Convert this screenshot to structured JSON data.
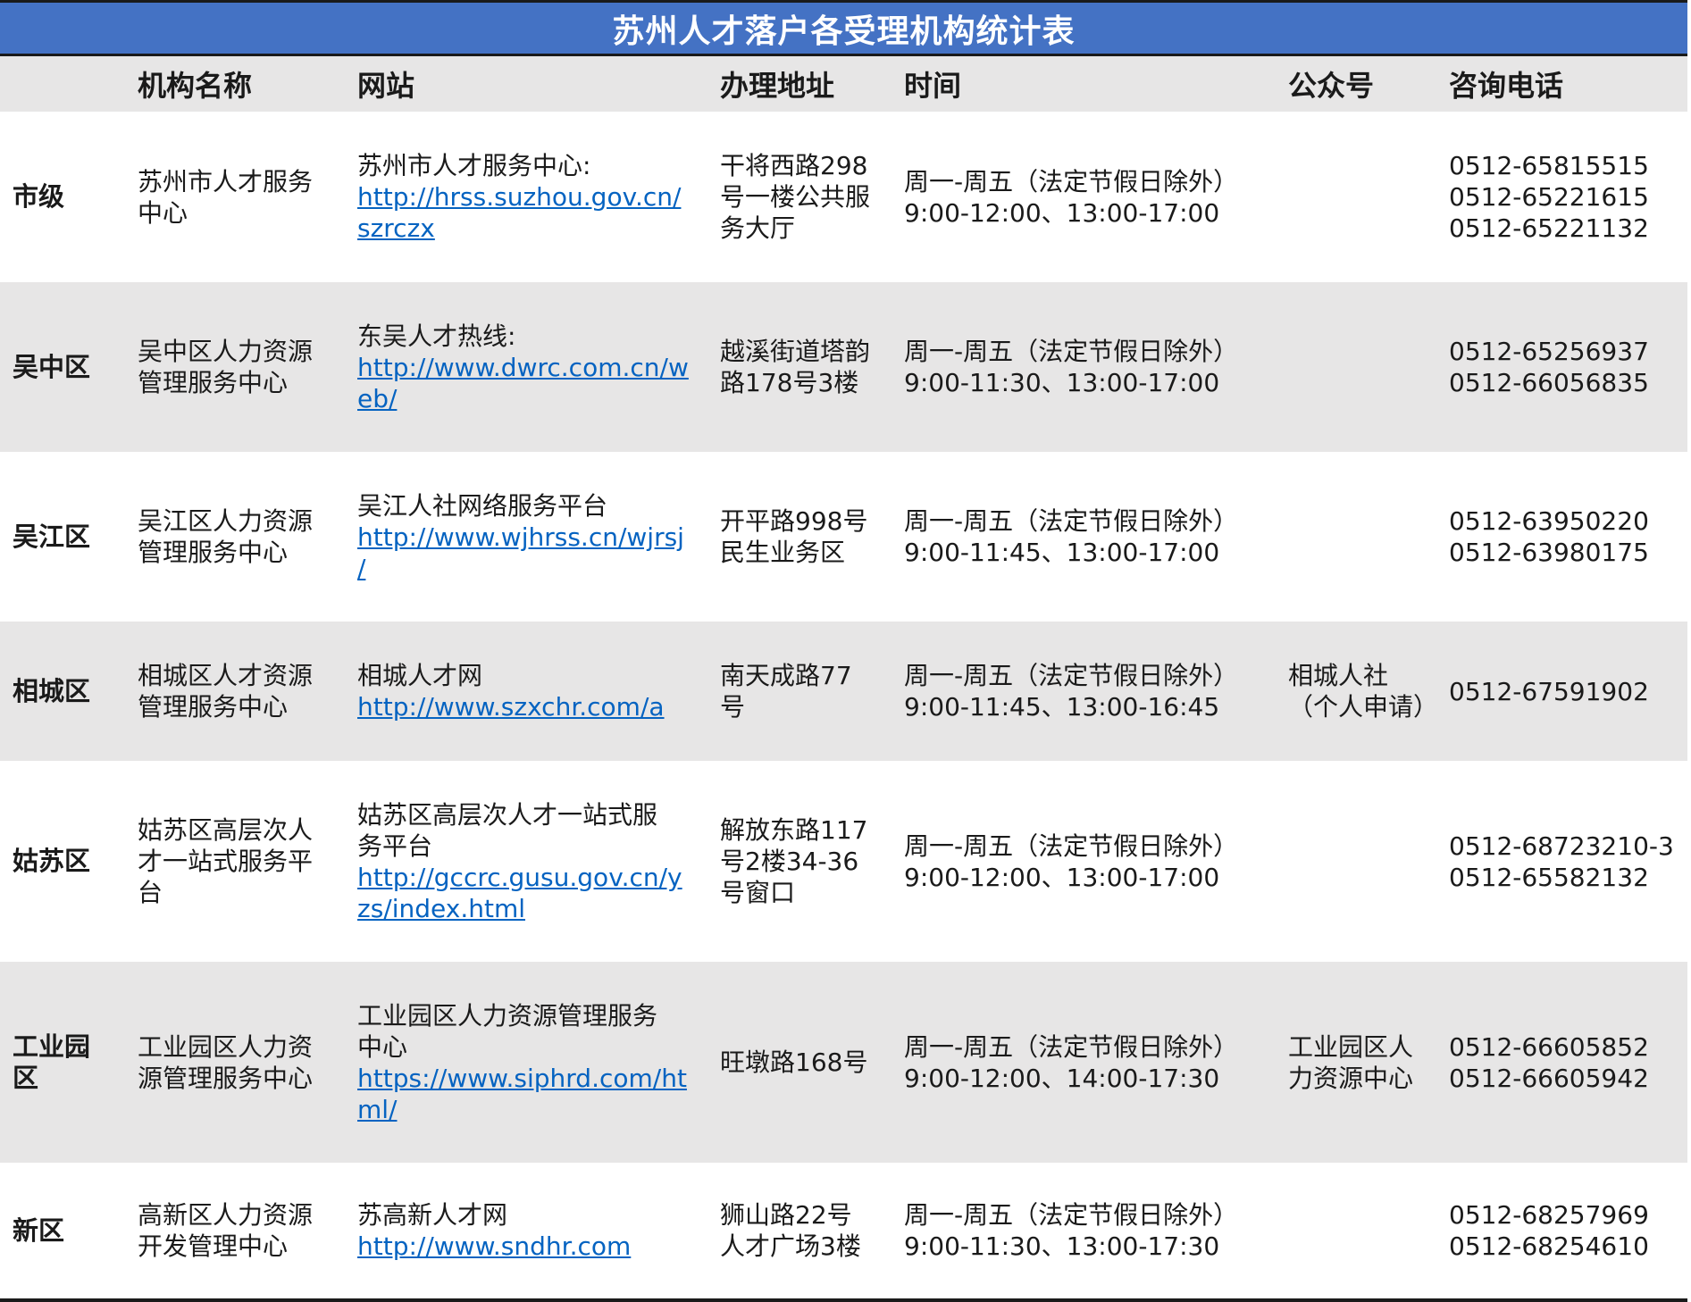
{
  "title": "苏州人才落户各受理机构统计表",
  "headers": {
    "org": "机构名称",
    "site": "网站",
    "addr": "办理地址",
    "time": "时间",
    "wechat": "公众号",
    "phone": "咨询电话"
  },
  "rows": [
    {
      "district": "市级",
      "org": [
        "苏州市人才服务",
        "中心"
      ],
      "site_name": [
        "苏州市人才服务中心:"
      ],
      "site_url": [
        "http://hrss.suzhou.gov.cn/",
        "szrczx"
      ],
      "addr": [
        "干将西路298",
        "号一楼公共服",
        "务大厅"
      ],
      "time": [
        "周一-周五（法定节假日除外）",
        "9:00-12:00、13:00-17:00"
      ],
      "wechat": [],
      "phones": [
        "0512-65815515",
        "0512-65221615",
        "0512-65221132"
      ]
    },
    {
      "district": "吴中区",
      "org": [
        "吴中区人力资源",
        "管理服务中心"
      ],
      "site_name": [
        "东吴人才热线:"
      ],
      "site_url": [
        "http://www.dwrc.com.cn/w",
        "eb/"
      ],
      "addr": [
        "越溪街道塔韵",
        "路178号3楼"
      ],
      "time": [
        "周一-周五（法定节假日除外）",
        "9:00-11:30、13:00-17:00"
      ],
      "wechat": [],
      "phones": [
        "0512-65256937",
        "0512-66056835"
      ]
    },
    {
      "district": "吴江区",
      "org": [
        "吴江区人力资源",
        "管理服务中心"
      ],
      "site_name": [
        "吴江人社网络服务平台"
      ],
      "site_url": [
        "http://www.wjhrss.cn/wjrsj",
        "/"
      ],
      "addr": [
        "开平路998号",
        "民生业务区"
      ],
      "time": [
        "周一-周五（法定节假日除外）",
        "9:00-11:45、13:00-17:00"
      ],
      "wechat": [],
      "phones": [
        "0512-63950220",
        "0512-63980175"
      ]
    },
    {
      "district": "相城区",
      "org": [
        "相城区人才资源",
        "管理服务中心"
      ],
      "site_name": [
        "相城人才网"
      ],
      "site_url": [
        "http://www.szxchr.com/a"
      ],
      "addr": [
        "南天成路77",
        "号"
      ],
      "time": [
        "周一-周五（法定节假日除外）",
        "9:00-11:45、13:00-16:45"
      ],
      "wechat": [
        "相城人社",
        "（个人申请）"
      ],
      "phones": [
        "0512-67591902"
      ]
    },
    {
      "district": "姑苏区",
      "org": [
        "姑苏区高层次人",
        "才一站式服务平",
        "台"
      ],
      "site_name": [
        "姑苏区高层次人才一站式服",
        "务平台"
      ],
      "site_url": [
        "http://gccrc.gusu.gov.cn/y",
        "zs/index.html"
      ],
      "addr": [
        "解放东路117",
        "号2楼34-36",
        "号窗口"
      ],
      "time": [
        "周一-周五（法定节假日除外）",
        "9:00-12:00、13:00-17:00"
      ],
      "wechat": [],
      "phones": [
        "0512-68723210-3",
        "0512-65582132"
      ]
    },
    {
      "district": "工业园区",
      "district_lines": [
        "工业园",
        "区"
      ],
      "org": [
        "工业园区人力资",
        "源管理服务中心"
      ],
      "site_name": [
        "工业园区人力资源管理服务",
        "中心"
      ],
      "site_url": [
        "https://www.siphrd.com/ht",
        "ml/"
      ],
      "addr": [
        "旺墩路168号"
      ],
      "time": [
        "周一-周五（法定节假日除外）",
        "9:00-12:00、14:00-17:30"
      ],
      "wechat": [
        "工业园区人",
        "力资源中心"
      ],
      "phones": [
        "0512-66605852",
        "0512-66605942"
      ]
    },
    {
      "district": "新区",
      "org": [
        "高新区人力资源",
        "开发管理中心"
      ],
      "site_name": [
        "苏高新人才网"
      ],
      "site_url": [
        "http://www.sndhr.com"
      ],
      "addr": [
        "狮山路22号",
        "人才广场3楼"
      ],
      "time": [
        "周一-周五（法定节假日除外）",
        "9:00-11:30、13:00-17:30"
      ],
      "wechat": [],
      "phones": [
        "0512-68257969",
        "0512-68254610"
      ]
    }
  ]
}
